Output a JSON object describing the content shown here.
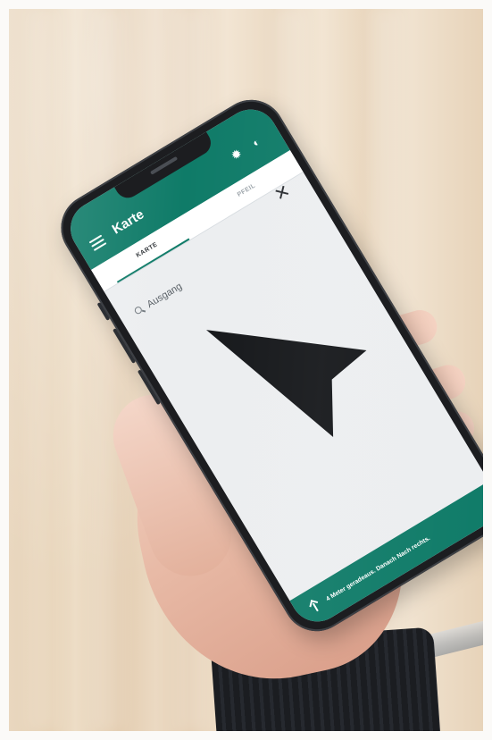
{
  "scene": {
    "description_colors": {
      "background_wall": "#e8d4ba",
      "app_accent": "#0f7b68",
      "screen_bg": "#eceef0",
      "arrow_color": "#15171a",
      "sleeve_color": "#1b1d21"
    }
  },
  "app": {
    "title": "Karte",
    "tabs": [
      {
        "label": "KARTE"
      },
      {
        "label": "PFEIL"
      }
    ],
    "search": {
      "value": "Ausgang"
    },
    "instruction": "4 Meter geradeaus. Danach Nach rechts."
  },
  "icons": {
    "menu": "menu-icon",
    "settings": "settings-icon",
    "sound": "sound-icon",
    "close": "close-icon",
    "search": "search-icon",
    "direction": "navigation-arrow-icon",
    "up": "arrow-up-icon"
  }
}
